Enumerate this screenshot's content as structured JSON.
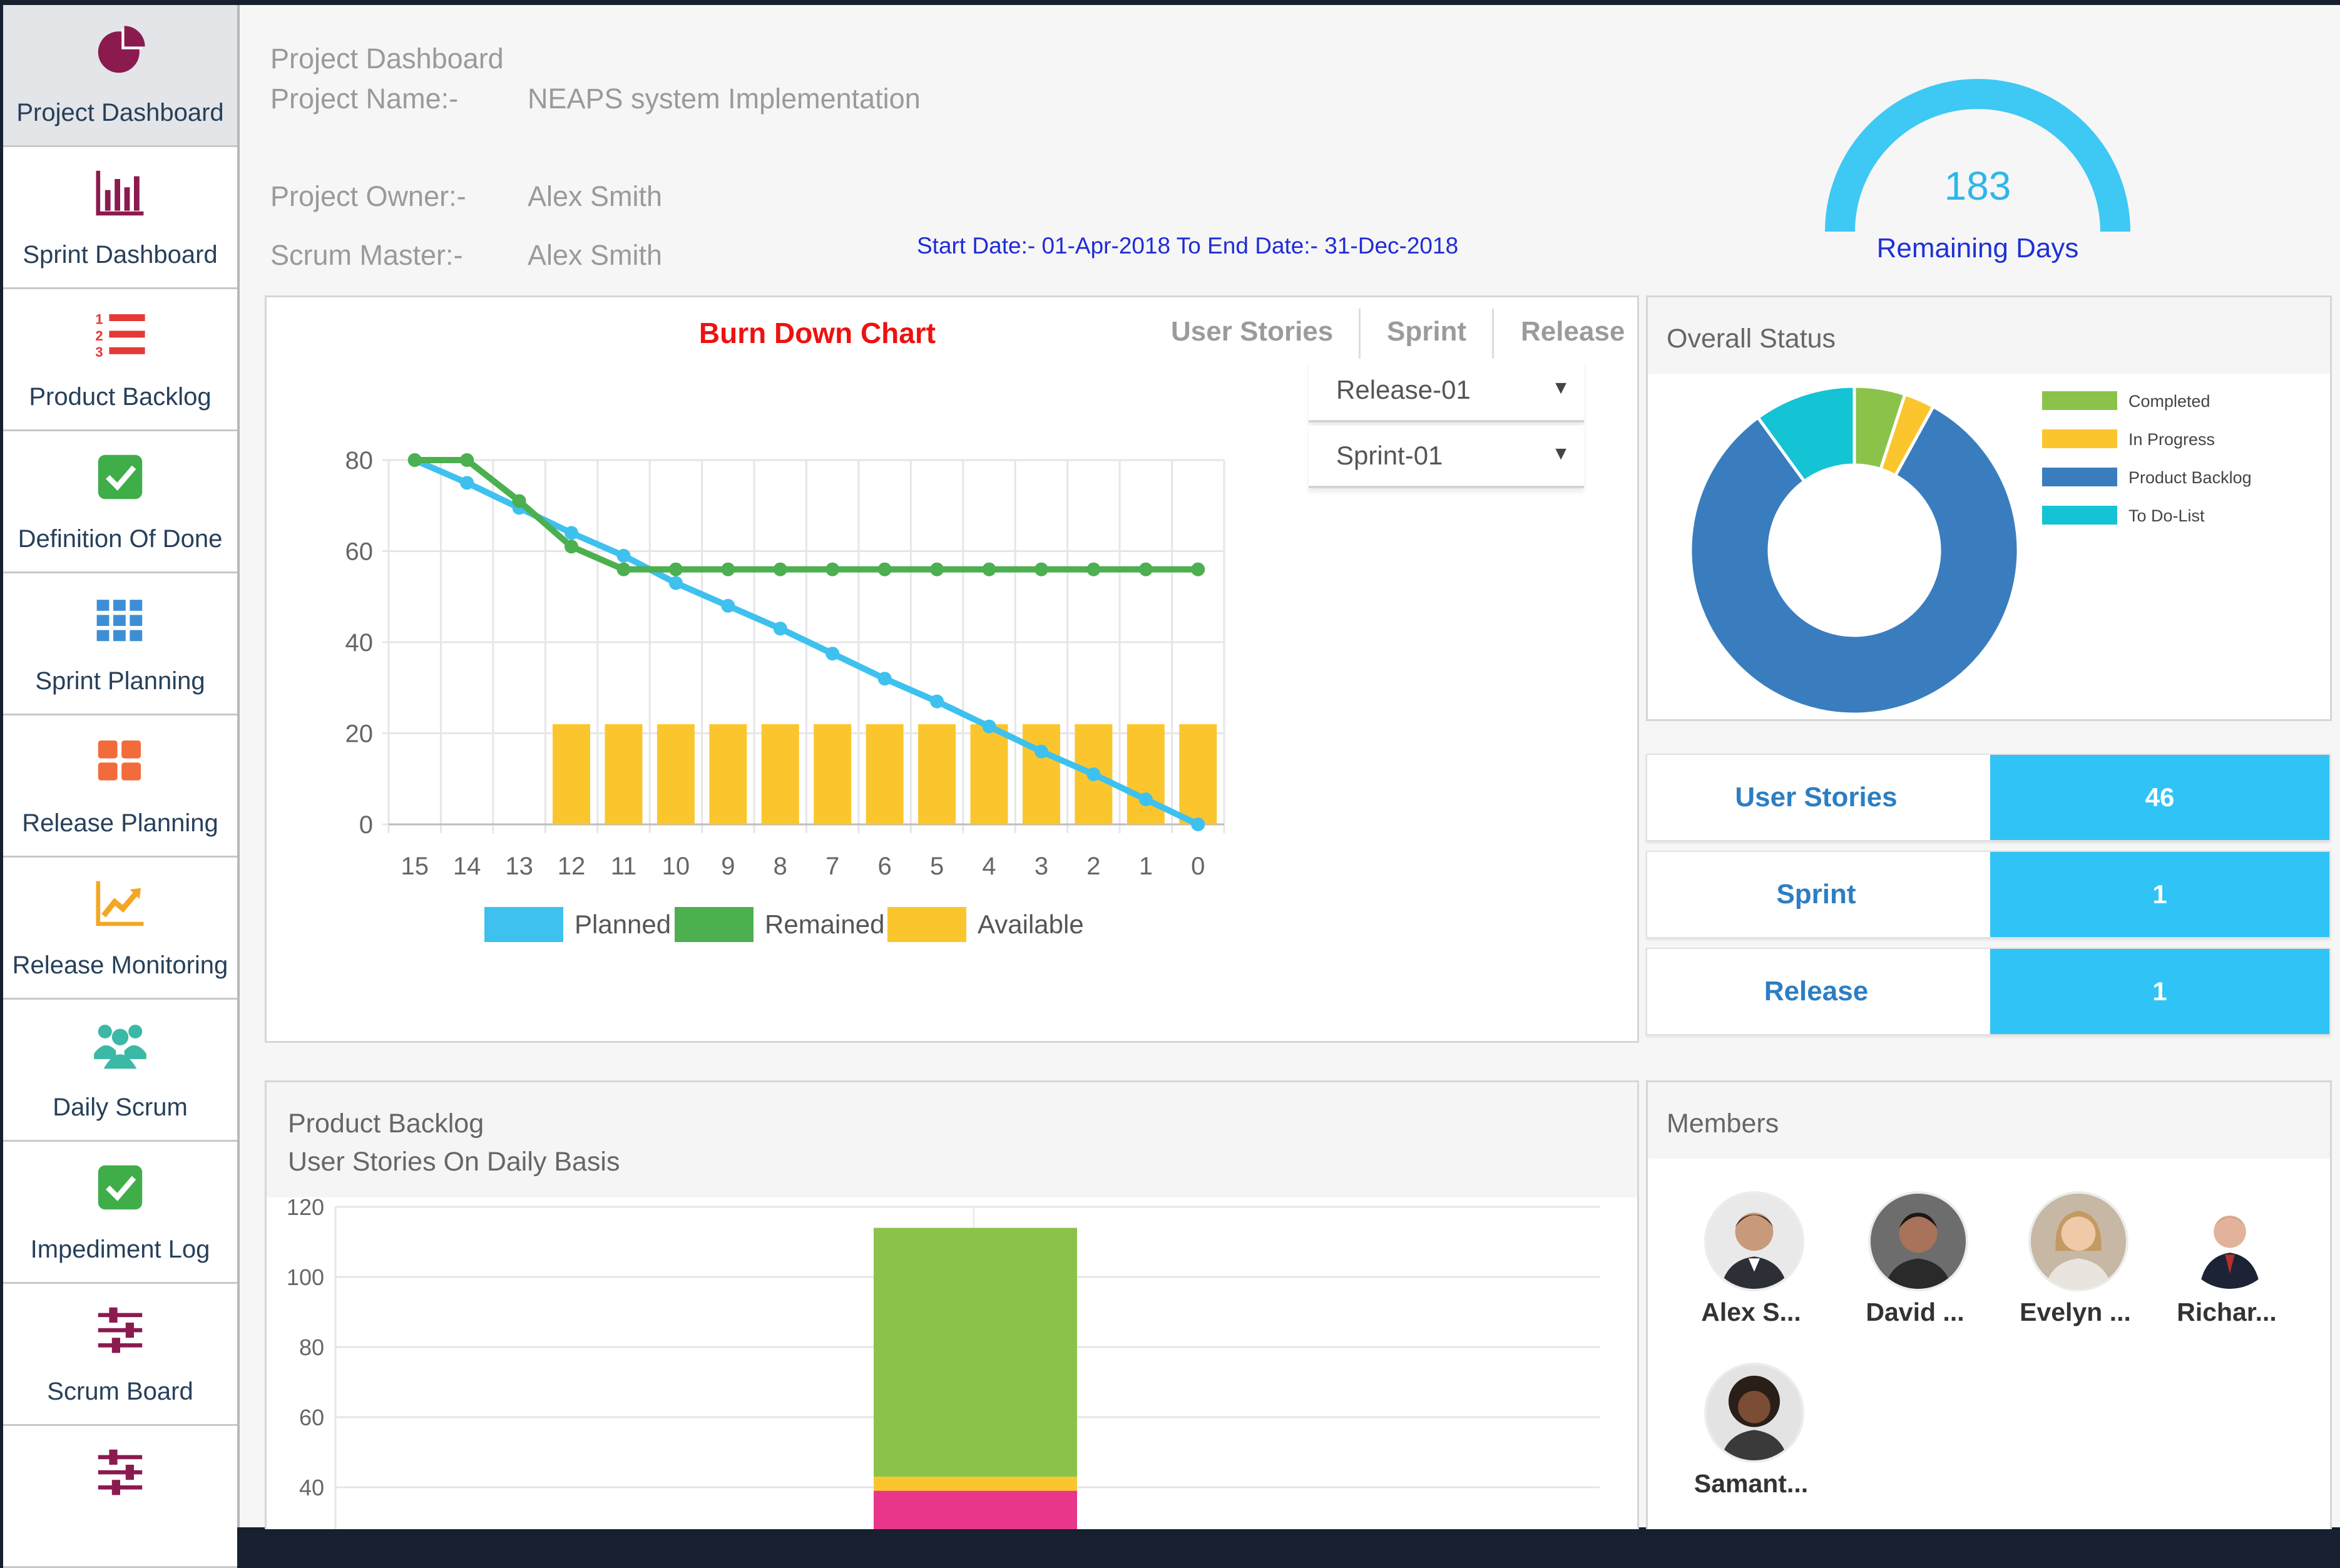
{
  "sidebar": {
    "items": [
      {
        "label": "Project Dashboard",
        "icon": "pie-chart-icon",
        "active": true
      },
      {
        "label": "Sprint Dashboard",
        "icon": "bar-chart-icon"
      },
      {
        "label": "Product Backlog",
        "icon": "numbered-list-icon"
      },
      {
        "label": "Definition Of Done",
        "icon": "checkbox-icon"
      },
      {
        "label": "Sprint Planning",
        "icon": "grid-icon"
      },
      {
        "label": "Release Planning",
        "icon": "tiles-icon"
      },
      {
        "label": "Release Monitoring",
        "icon": "trend-chart-icon"
      },
      {
        "label": "Daily Scrum",
        "icon": "team-icon"
      },
      {
        "label": "Impediment Log",
        "icon": "checkbox-icon"
      },
      {
        "label": "Scrum Board",
        "icon": "sliders-icon"
      },
      {
        "label": "",
        "icon": "sliders-icon"
      }
    ]
  },
  "header": {
    "title": "Project Dashboard",
    "project_name_label": "Project Name:-",
    "project_name": "NEAPS system Implementation",
    "owner_label": "Project Owner:-",
    "owner": "Alex Smith",
    "scrum_master_label": "Scrum Master:-",
    "scrum_master": "Alex Smith",
    "dates": "Start Date:- 01-Apr-2018 To End Date:- 31-Dec-2018"
  },
  "gauge": {
    "value": "183",
    "label": "Remaining Days"
  },
  "burndown": {
    "title": "Burn Down Chart",
    "tabs": [
      "User Stories",
      "Sprint",
      "Release"
    ],
    "release_select": "Release-01",
    "sprint_select": "Sprint-01"
  },
  "overall_status": {
    "title": "Overall Status",
    "legend": [
      {
        "label": "Completed",
        "color": "#8bc34a"
      },
      {
        "label": "In Progress",
        "color": "#fbc62d"
      },
      {
        "label": "Product Backlog",
        "color": "#3a7dbf"
      },
      {
        "label": "To Do-List",
        "color": "#14c3d4"
      }
    ]
  },
  "stats": [
    {
      "label": "User Stories",
      "value": "46"
    },
    {
      "label": "Sprint",
      "value": "1"
    },
    {
      "label": "Release",
      "value": "1"
    }
  ],
  "backlog_panel": {
    "title": "Product Backlog",
    "subtitle": "User Stories On Daily Basis"
  },
  "members": {
    "title": "Members",
    "list": [
      "Alex S...",
      "David ...",
      "Evelyn ...",
      "Richar...",
      "Samant..."
    ]
  },
  "chart_data": [
    {
      "type": "line",
      "title": "Burn Down Chart",
      "x": [
        "15",
        "14",
        "13",
        "12",
        "11",
        "10",
        "9",
        "8",
        "7",
        "6",
        "5",
        "4",
        "3",
        "2",
        "1",
        "0"
      ],
      "ylim": [
        0,
        80
      ],
      "yticks": [
        0,
        20,
        40,
        60,
        80
      ],
      "grid": true,
      "legend_position": "bottom",
      "series": [
        {
          "name": "Planned",
          "kind": "line",
          "color": "#3ec1ee",
          "values": [
            80,
            75,
            69.5,
            64,
            59,
            53,
            48,
            43,
            37.5,
            32,
            27,
            21.5,
            16,
            11,
            5.5,
            0
          ]
        },
        {
          "name": "Remained",
          "kind": "line",
          "color": "#4caf50",
          "values": [
            80,
            80,
            71,
            61,
            56,
            56,
            56,
            56,
            56,
            56,
            56,
            56,
            56,
            56,
            56,
            56
          ]
        },
        {
          "name": "Available",
          "kind": "bar",
          "color": "#fbc62d",
          "values": [
            null,
            null,
            null,
            22,
            22,
            22,
            22,
            22,
            22,
            22,
            22,
            22,
            22,
            22,
            22,
            22
          ]
        }
      ]
    },
    {
      "type": "pie",
      "title": "Overall Status",
      "donut": true,
      "legend_position": "right",
      "slices": [
        {
          "label": "Completed",
          "value": 5,
          "color": "#8bc34a"
        },
        {
          "label": "In Progress",
          "value": 3,
          "color": "#fbc62d"
        },
        {
          "label": "Product Backlog",
          "value": 82,
          "color": "#3a7dbf"
        },
        {
          "label": "To Do-List",
          "value": 10,
          "color": "#14c3d4"
        }
      ]
    },
    {
      "type": "bar",
      "title": "Product Backlog",
      "subtitle": "User Stories On Daily Basis",
      "ylim": [
        40,
        120
      ],
      "yticks": [
        40,
        60,
        80,
        100,
        120
      ],
      "grid": true,
      "stacked": true,
      "series": [
        {
          "segment": "bottom",
          "color": "#e8368a",
          "value": 39
        },
        {
          "segment": "middle",
          "color": "#fbc62d",
          "value": 4
        },
        {
          "segment": "top",
          "color": "#8bc34a",
          "value": 71
        }
      ]
    }
  ]
}
